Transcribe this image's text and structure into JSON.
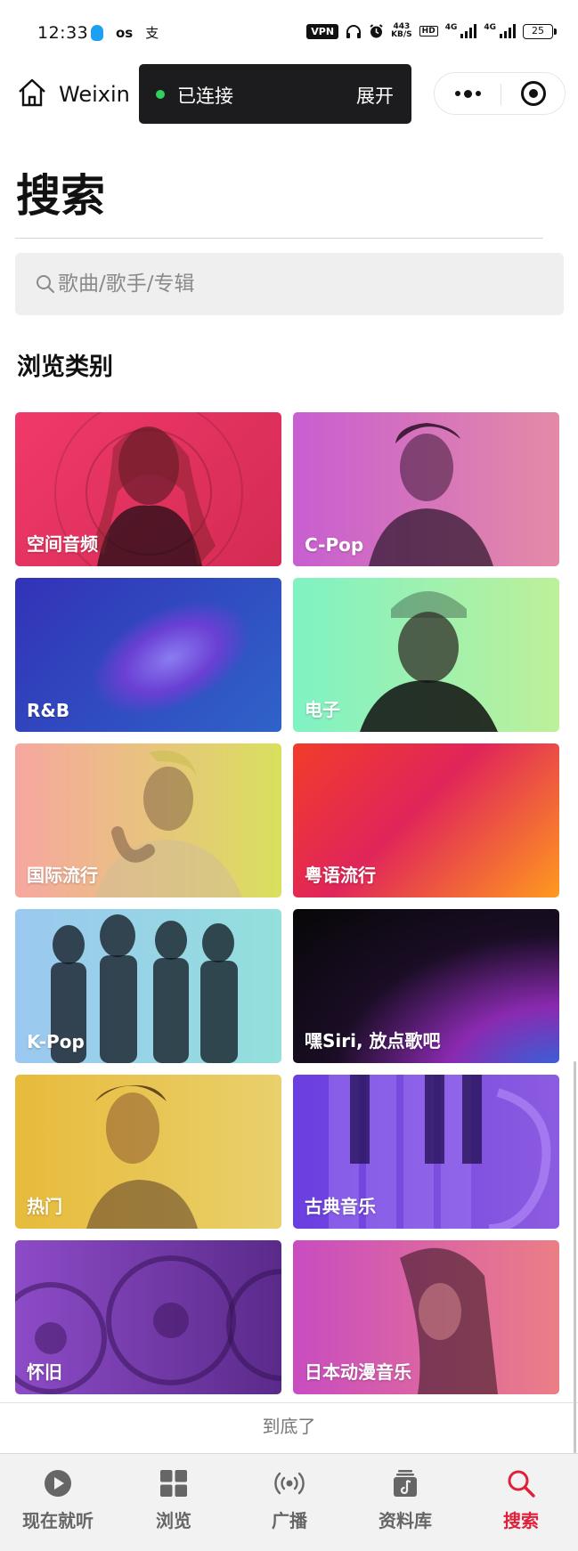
{
  "status_bar": {
    "time": "12:33",
    "left_icons": [
      "qq-icon",
      "oos-icon",
      "alipay-icon"
    ],
    "oos_text": "ᴏs",
    "alipay_text": "支",
    "vpn": "VPN",
    "net_speed_value": "443",
    "net_speed_unit": "KB/S",
    "hd": "HD",
    "signal_label_1": "4G",
    "signal_label_2": "4G",
    "battery": "25"
  },
  "nav": {
    "title": "Weixin",
    "connection_status": "已连接",
    "expand_label": "展开"
  },
  "page": {
    "title": "搜索",
    "search_placeholder": "歌曲/歌手/专辑",
    "section_title": "浏览类别",
    "end_text": "到底了"
  },
  "categories": [
    {
      "label": "空间音频",
      "colors": [
        "#f0396a",
        "#d42b53"
      ]
    },
    {
      "label": "C-Pop",
      "colors": [
        "#c85ed1",
        "#e48aa6"
      ]
    },
    {
      "label": "R&B",
      "colors": [
        "#3232b8",
        "#2f63c8"
      ]
    },
    {
      "label": "电子",
      "colors": [
        "#7ff2c4",
        "#bdf09a"
      ]
    },
    {
      "label": "国际流行",
      "colors": [
        "#f7a7a0",
        "#d9e05d"
      ]
    },
    {
      "label": "粤语流行",
      "colors": [
        "#f23c2a",
        "#ff9a1e"
      ]
    },
    {
      "label": "K-Pop",
      "colors": [
        "#9bc8f0",
        "#93e0dc"
      ]
    },
    {
      "label": "嘿Siri, 放点歌吧",
      "colors": [
        "#070707",
        "#1e2a58"
      ]
    },
    {
      "label": "热门",
      "colors": [
        "#e7bb3b",
        "#e9d06c"
      ]
    },
    {
      "label": "古典音乐",
      "colors": [
        "#6a3ee0",
        "#8c5ce0"
      ]
    },
    {
      "label": "怀旧",
      "colors": [
        "#8d4bc7",
        "#5a2a8a"
      ]
    },
    {
      "label": "日本动漫音乐",
      "colors": [
        "#c94cc0",
        "#ec7e86"
      ]
    }
  ],
  "tabs": [
    {
      "label": "现在就听",
      "icon": "play-circle-icon"
    },
    {
      "label": "浏览",
      "icon": "grid-icon"
    },
    {
      "label": "广播",
      "icon": "broadcast-icon"
    },
    {
      "label": "资料库",
      "icon": "library-icon"
    },
    {
      "label": "搜索",
      "icon": "search-icon",
      "active": true
    }
  ],
  "colors": {
    "accent": "#e0203a",
    "connected": "#2fd15a",
    "pill_bg": "#1c1c1e"
  }
}
